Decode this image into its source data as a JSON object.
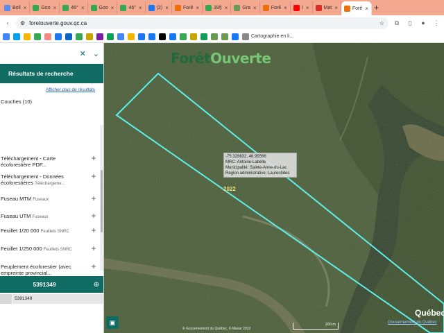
{
  "browser": {
    "tabs": [
      {
        "label": "Boll",
        "color": "#5b8def"
      },
      {
        "label": "Goo",
        "color": "#34a853"
      },
      {
        "label": "46°",
        "color": "#34a853"
      },
      {
        "label": "Goo",
        "color": "#34a853"
      },
      {
        "label": "46°",
        "color": "#34a853"
      },
      {
        "label": "(2)",
        "color": "#1877f2"
      },
      {
        "label": "Forê",
        "color": "#e8710a"
      },
      {
        "label": "39§",
        "color": "#34a853"
      },
      {
        "label": "Gra",
        "color": "#6a9955"
      },
      {
        "label": "Forê",
        "color": "#e8710a"
      },
      {
        "label": "Ⅰ",
        "color": "#ff0000"
      },
      {
        "label": "Mat",
        "color": "#d93025"
      },
      {
        "label": "Forê",
        "color": "#e8710a",
        "active": true
      }
    ],
    "url": "foretouverte.gouv.qc.ca",
    "bookmark_label": "Cartographie en li..."
  },
  "panel": {
    "results_title": "Résultats de recherche",
    "more_results": "Afficher plus de résultats",
    "layers_count": "Couches (10)",
    "layers": [
      {
        "label": "Téléchargement - Carte écoforestière PDF...",
        "sub": ""
      },
      {
        "label": "Téléchargement - Données écoforestières",
        "sub": "Téléchargeme..."
      },
      {
        "label": "Fuseau MTM",
        "sub": "Fuseaux"
      },
      {
        "label": "Fuseau UTM",
        "sub": "Fuseaux"
      },
      {
        "label": "Feuillet 1/20 000",
        "sub": "Feuillets SNRC"
      },
      {
        "label": "Feuillet 1/250 000",
        "sub": "Feuillets SNRC"
      },
      {
        "label": "Peuplement écoforestier (avec empreinte provincial...",
        "sub": ""
      }
    ],
    "selected_result": "5391349",
    "row_value": "5391349"
  },
  "map": {
    "logo_main": "Forêt",
    "logo_accent": "Ouverte",
    "popup_lines": [
      "-75.328632, 46.95566",
      "MRC: Antoine-Labelle",
      "Municipalité: Sainte-Anne-du-Lac",
      "Région administrative: Laurentides"
    ],
    "year": "2022",
    "attribution": "© Gouvernement du Québec, © Maxar 2022",
    "scale": "200 m",
    "quebec": "Québec",
    "quebec_link": "Gouvernement du Québec",
    "outline_color": "#5ff0ea"
  }
}
